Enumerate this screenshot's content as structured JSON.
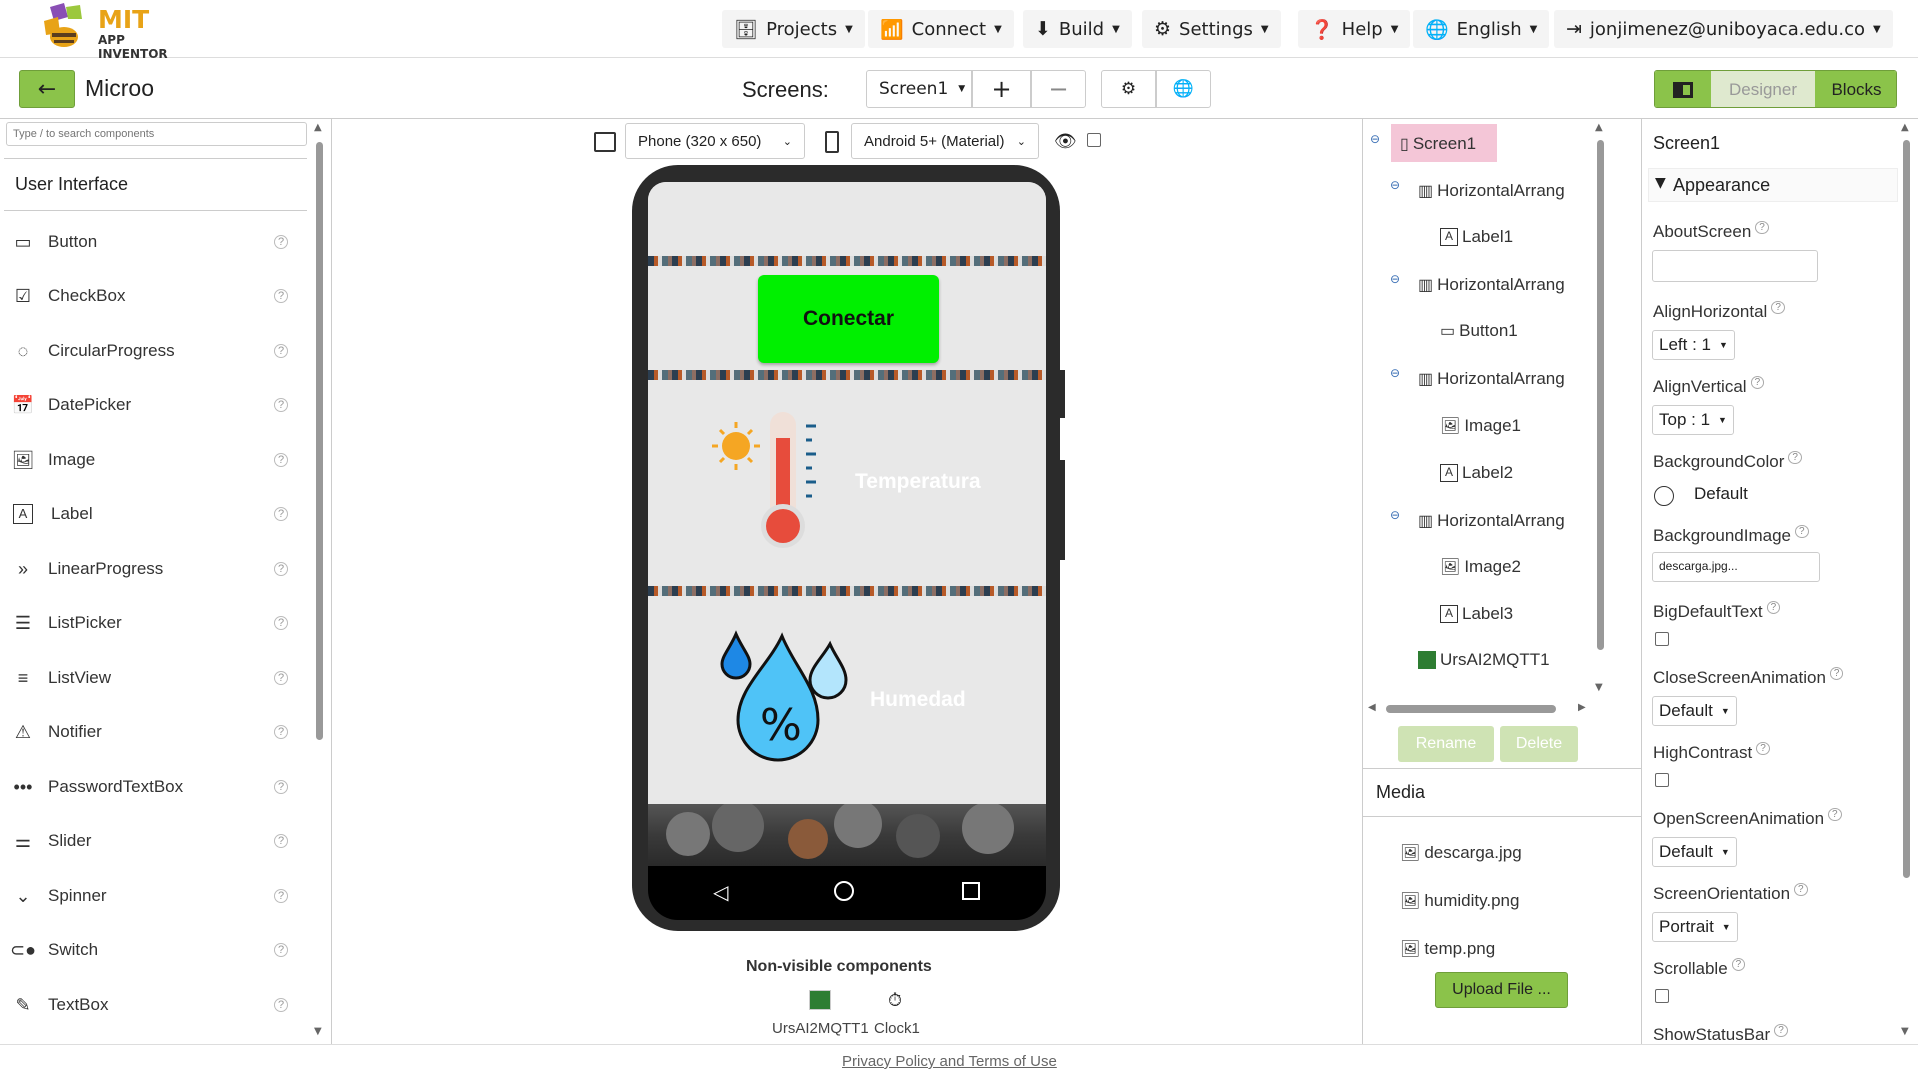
{
  "brand": {
    "line1": "MIT",
    "line2": "APP INVENTOR"
  },
  "topmenu": {
    "projects": "Projects",
    "connect": "Connect",
    "build": "Build",
    "settings": "Settings",
    "help": "Help",
    "language": "English",
    "account": "jonjimenez@uniboyaca.edu.co"
  },
  "project": {
    "name": "Microo",
    "screens_label": "Screens:",
    "current_screen": "Screen1"
  },
  "modes": {
    "designer": "Designer",
    "blocks": "Blocks"
  },
  "palette": {
    "search_placeholder": "Type / to search components",
    "category": "User Interface",
    "items": [
      {
        "label": "Button",
        "icon": "button-icon"
      },
      {
        "label": "CheckBox",
        "icon": "checkbox-icon"
      },
      {
        "label": "CircularProgress",
        "icon": "circular-progress-icon"
      },
      {
        "label": "DatePicker",
        "icon": "calendar-icon"
      },
      {
        "label": "Image",
        "icon": "image-icon"
      },
      {
        "label": "Label",
        "icon": "label-icon"
      },
      {
        "label": "LinearProgress",
        "icon": "chevrons-icon"
      },
      {
        "label": "ListPicker",
        "icon": "list-icon"
      },
      {
        "label": "ListView",
        "icon": "listview-icon"
      },
      {
        "label": "Notifier",
        "icon": "warning-icon"
      },
      {
        "label": "PasswordTextBox",
        "icon": "password-icon"
      },
      {
        "label": "Slider",
        "icon": "slider-icon"
      },
      {
        "label": "Spinner",
        "icon": "spinner-icon"
      },
      {
        "label": "Switch",
        "icon": "switch-icon"
      },
      {
        "label": "TextBox",
        "icon": "textbox-icon"
      }
    ]
  },
  "viewer": {
    "device": "Phone (320 x 650)",
    "theme": "Android 5+ (Material)",
    "button_text": "Conectar",
    "label2": "Temperatura",
    "label3": "Humedad",
    "nonvisible_title": "Non-visible components",
    "nonvisible": [
      "UrsAI2MQTT1",
      "Clock1"
    ]
  },
  "tree": {
    "items": [
      "Screen1",
      "HorizontalArrang",
      "Label1",
      "HorizontalArrang",
      "Button1",
      "HorizontalArrang",
      "Image1",
      "Label2",
      "HorizontalArrang",
      "Image2",
      "Label3",
      "UrsAI2MQTT1"
    ],
    "rename": "Rename",
    "delete": "Delete"
  },
  "media": {
    "title": "Media",
    "files": [
      "descarga.jpg",
      "humidity.png",
      "temp.png"
    ],
    "upload": "Upload File ..."
  },
  "properties": {
    "component": "Screen1",
    "section": "Appearance",
    "about_screen": "AboutScreen",
    "align_horizontal": "AlignHorizontal",
    "align_horizontal_value": "Left : 1",
    "align_vertical": "AlignVertical",
    "align_vertical_value": "Top : 1",
    "background_color": "BackgroundColor",
    "background_color_value": "Default",
    "background_image": "BackgroundImage",
    "background_image_value": "descarga.jpg...",
    "big_default_text": "BigDefaultText",
    "close_screen_animation": "CloseScreenAnimation",
    "close_screen_animation_value": "Default",
    "high_contrast": "HighContrast",
    "open_screen_animation": "OpenScreenAnimation",
    "open_screen_animation_value": "Default",
    "screen_orientation": "ScreenOrientation",
    "screen_orientation_value": "Portrait",
    "scrollable": "Scrollable",
    "show_status_bar": "ShowStatusBar"
  },
  "footer": {
    "privacy": "Privacy Policy and Terms of Use"
  },
  "colors": {
    "accent_green": "#8bc34a",
    "conectar_green": "#00f000",
    "selected_pink": "#f4c6d7"
  }
}
